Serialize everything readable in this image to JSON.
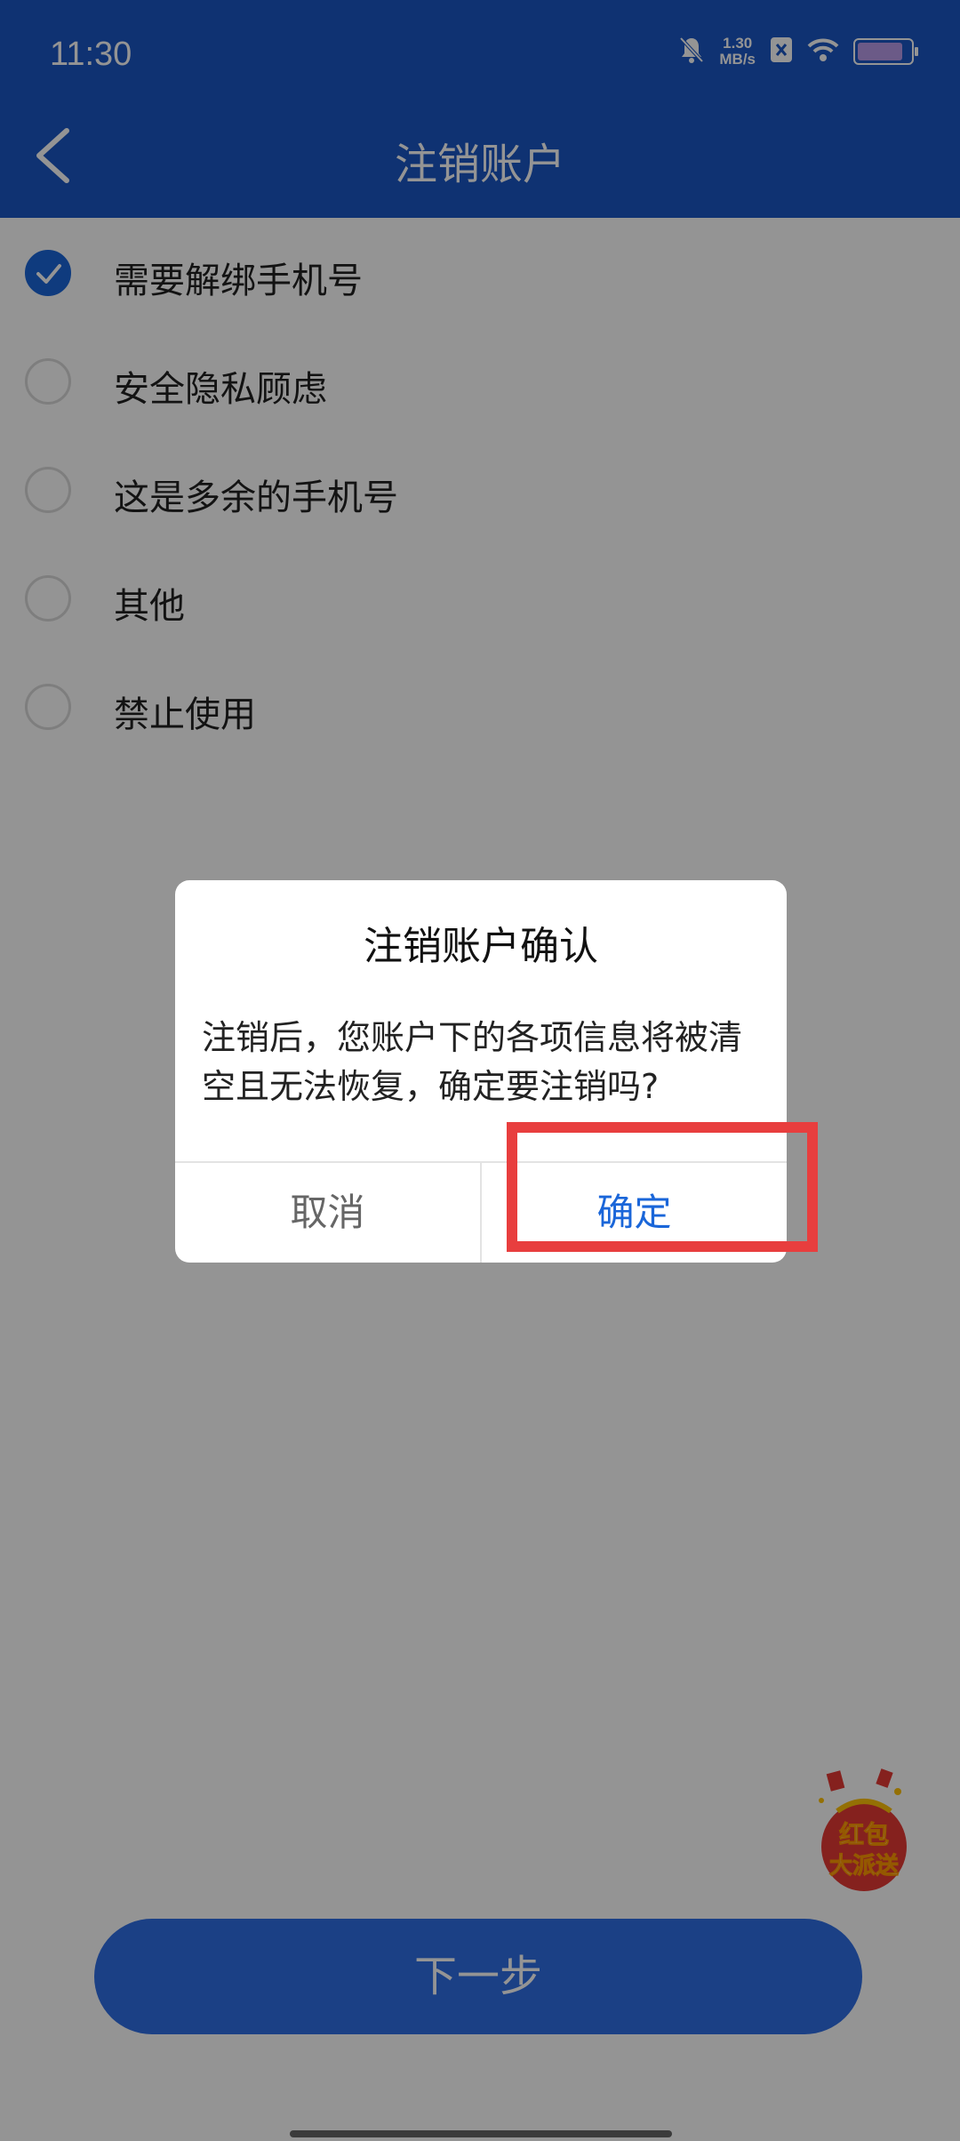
{
  "status_bar": {
    "time": "11:30",
    "speed_value": "1.30",
    "speed_unit": "MB/s",
    "battery_level": 0.9
  },
  "header": {
    "title": "注销账户",
    "back_icon": "chevron-left-icon"
  },
  "options": [
    {
      "label": "需要解绑手机号",
      "checked": true
    },
    {
      "label": "安全隐私顾虑",
      "checked": false
    },
    {
      "label": "这是多余的手机号",
      "checked": false
    },
    {
      "label": "其他",
      "checked": false
    },
    {
      "label": "禁止使用",
      "checked": false
    }
  ],
  "next_button": {
    "label": "下一步"
  },
  "red_packet": {
    "line1": "红包",
    "line2": "大派送"
  },
  "dialog": {
    "title": "注销账户确认",
    "message": "注销后，您账户下的各项信息将被清空且无法恢复，确定要注销吗?",
    "cancel_label": "取消",
    "confirm_label": "确定"
  },
  "colors": {
    "primary": "#1a56c4",
    "accent": "#1a66d9",
    "highlight": "#e83e3e"
  }
}
